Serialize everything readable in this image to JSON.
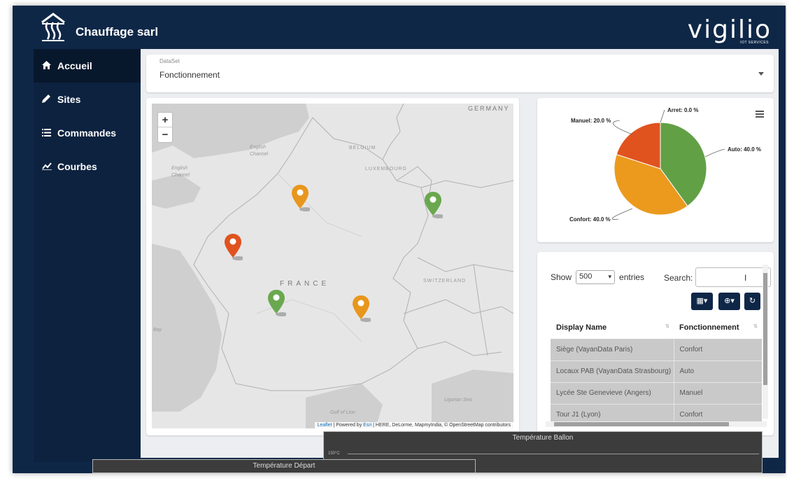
{
  "header": {
    "company_name": "Chauffage sarl",
    "vendor_logo_text": "vigilio",
    "vendor_tagline": "IOT SERVICES"
  },
  "sidebar": {
    "items": [
      {
        "label": "Accueil",
        "icon": "home-icon",
        "active": true
      },
      {
        "label": "Sites",
        "icon": "pencil-icon",
        "active": false
      },
      {
        "label": "Commandes",
        "icon": "list-icon",
        "active": false
      },
      {
        "label": "Courbes",
        "icon": "chart-icon",
        "active": false
      }
    ],
    "collapse_label": "‹"
  },
  "dataset": {
    "label": "DataSet",
    "value": "Fonctionnement"
  },
  "map": {
    "labels": {
      "germany": "GERMANY",
      "belgium": "BELGIUM",
      "luxembourg": "LUXEMBOURG",
      "france": "FRANCE",
      "switzerland": "SWITZERLAND",
      "english_channel_1": "English Channel",
      "english_channel_2": "English Channel",
      "gulf": "Gulf of Lion",
      "ligurian": "Ligurian Sea",
      "bay": "Bay"
    },
    "zoom_in": "+",
    "zoom_out": "−",
    "attribution": {
      "leaflet": "Leaflet",
      "powered": " | Powered by ",
      "esri": "Esri",
      "rest": " | HERE, DeLorme, MapmyIndia, © OpenStreetMap contributors"
    },
    "marker_colors": {
      "Confort": "#e8961c",
      "Auto": "#6aa84f",
      "Manuel": "#e0531f"
    }
  },
  "chart_data": {
    "type": "pie",
    "slices": [
      {
        "label": "Auto: 40.0 %",
        "name": "Auto",
        "value": 40.0,
        "color": "#62a046"
      },
      {
        "label": "Confort: 40.0 %",
        "name": "Confort",
        "value": 40.0,
        "color": "#eb9a1e"
      },
      {
        "label": "Manuel: 20.0 %",
        "name": "Manuel",
        "value": 20.0,
        "color": "#e0531f"
      },
      {
        "label": "Arret: 0.0 %",
        "name": "Arret",
        "value": 0.0,
        "color": "#999999"
      }
    ]
  },
  "table": {
    "show_label": "Show",
    "show_value": "500",
    "entries_label": "entries",
    "search_label": "Search:",
    "columns": [
      "Display Name",
      "Fonctionnement"
    ],
    "rows": [
      [
        "Siège (VayanData Paris)",
        "Confort"
      ],
      [
        "Locaux PAB (VayanData Strasbourg)",
        "Auto"
      ],
      [
        "Lycée Ste Genevieve (Angers)",
        "Manuel"
      ],
      [
        "Tour J1 (Lyon)",
        "Confort"
      ]
    ]
  },
  "bottom_panels": {
    "ballon_title": "Température Ballon",
    "ballon_axis_label": "150°C",
    "depart_title": "Température Départ"
  }
}
